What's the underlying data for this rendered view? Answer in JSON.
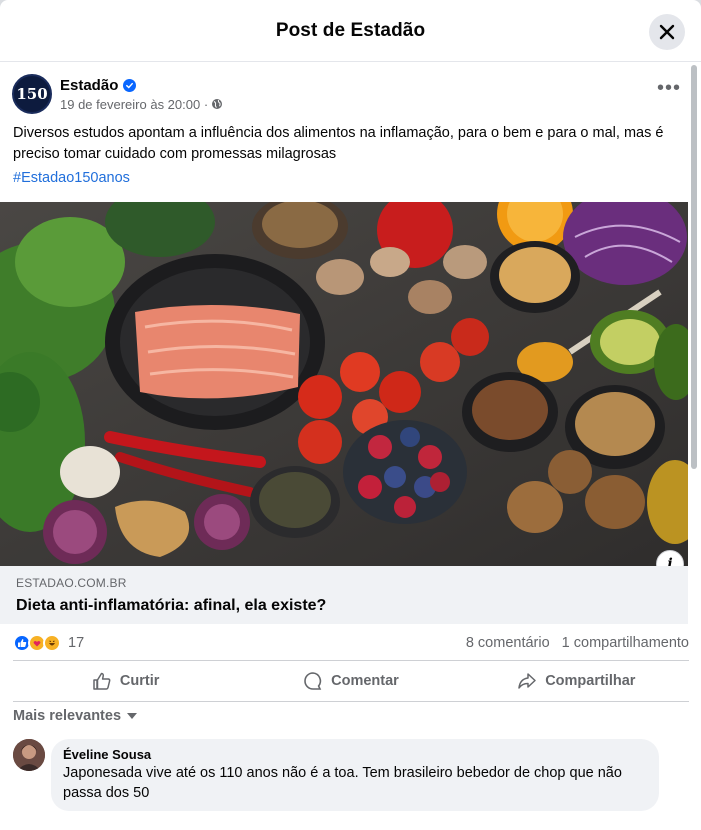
{
  "modal": {
    "title": "Post de Estadão"
  },
  "post": {
    "avatar_text": "150",
    "author": "Estadão",
    "timestamp": "19 de fevereiro às 20:00 ·",
    "text": "Diversos estudos apontam a influência dos alimentos na inflamação, para o bem e para o mal, mas é preciso tomar cuidado com promessas milagrosas",
    "hashtag": "#Estadao150anos",
    "image_icon": "food-photo-salmon-vegetables",
    "link": {
      "domain": "ESTADAO.COM.BR",
      "title": "Dieta anti-inflamatória: afinal, ela existe?"
    },
    "reactions": {
      "count": "17",
      "icons": [
        "like-icon",
        "care-icon",
        "haha-icon"
      ]
    },
    "comments_count": "8 comentário",
    "shares_count": "1 compartilhamento"
  },
  "actions": {
    "like": "Curtir",
    "comment": "Comentar",
    "share": "Compartilhar"
  },
  "comments_sort": "Mais relevantes",
  "comments": [
    {
      "author": "Éveline Sousa",
      "text": "Japonesada vive até os 110 anos não é a toa. Tem brasileiro bebedor de chop que não passa dos 50"
    }
  ],
  "colors": {
    "accent": "#0866ff",
    "hashtag": "#216fdb",
    "secondary_text": "#65676b"
  }
}
